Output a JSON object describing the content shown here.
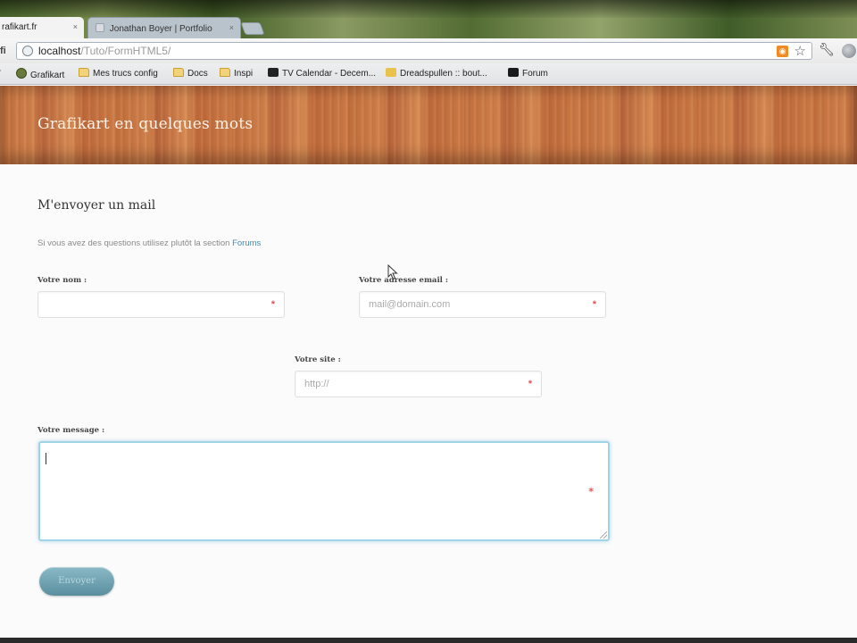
{
  "browser": {
    "tabs": [
      {
        "label": "rafikart.fr",
        "active": true
      },
      {
        "label": "Jonathan Boyer | Portfolio",
        "active": false
      }
    ],
    "tab_close_glyph": "×",
    "address": {
      "host": "localhost",
      "path": "/Tuto/FormHTML5/"
    },
    "page_icon_text": "fi",
    "bookmarks": [
      {
        "label": "Grafikart",
        "icon": "grafikart-icon"
      },
      {
        "label": "Mes trucs config",
        "icon": "folder-icon"
      },
      {
        "label": "Docs",
        "icon": "folder-icon"
      },
      {
        "label": "Inspi",
        "icon": "folder-icon"
      },
      {
        "label": "TV Calendar - Decem...",
        "icon": "tv-calendar-icon"
      },
      {
        "label": "Dreadspullen :: bout...",
        "icon": "dreadspullen-icon"
      },
      {
        "label": "Forum",
        "icon": "forum-icon"
      }
    ],
    "bookmarks_left_glyph": "r"
  },
  "page": {
    "header_title": "Grafikart en quelques mots",
    "section_title": "M'envoyer un mail",
    "intro": {
      "text": "Si vous avez des questions utilisez plutôt la section ",
      "link": "Forums"
    },
    "form": {
      "name": {
        "label": "Votre nom :",
        "placeholder": "",
        "required_mark": "*"
      },
      "email": {
        "label": "Votre adresse email :",
        "placeholder": "mail@domain.com",
        "required_mark": "*"
      },
      "site": {
        "label": "Votre site :",
        "placeholder": "http://",
        "required_mark": "*"
      },
      "message": {
        "label": "Votre message :",
        "required_mark": "*"
      },
      "submit_label": "Envoyer"
    }
  },
  "colors": {
    "accent": "#9fd3e6",
    "button": "#6d9fad",
    "required": "#e05555",
    "link": "#4a8aa6"
  }
}
